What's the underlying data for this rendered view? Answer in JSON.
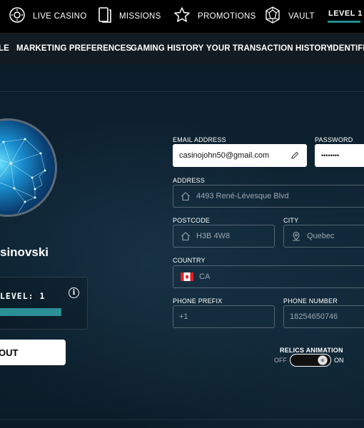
{
  "nav": {
    "items": [
      {
        "label": "LIVE CASINO",
        "icon": "roulette-icon"
      },
      {
        "label": "MISSIONS",
        "icon": "cards-icon"
      },
      {
        "label": "PROMOTIONS",
        "icon": "star-icon"
      },
      {
        "label": "VAULT",
        "icon": "gem-icon"
      }
    ],
    "level_label": "LEVEL 1",
    "level_color": "#1f8e8e"
  },
  "tabs": [
    {
      "label": "LE"
    },
    {
      "label": "MARKETING PREFERENCES"
    },
    {
      "label": "GAMING HISTORY"
    },
    {
      "label": "YOUR TRANSACTION HISTORY"
    },
    {
      "label": "IDENTIFI"
    }
  ],
  "profile": {
    "username": "sinovski",
    "level_text": "LEVEL: 1",
    "progress": 1.0,
    "progress_color": "#2b8f96",
    "logout_label": "OUT"
  },
  "form": {
    "email": {
      "label": "EMAIL ADDRESS",
      "value": "casinojohn50@gmail.com"
    },
    "password": {
      "label": "PASSWORD",
      "value": "••••••••"
    },
    "address": {
      "label": "ADDRESS",
      "value": "4493 René-Lévesque Blvd"
    },
    "postcode": {
      "label": "POSTCODE",
      "value": "H3B 4W8"
    },
    "city": {
      "label": "CITY",
      "value": "Quebec"
    },
    "country": {
      "label": "COUNTRY",
      "value": "CA"
    },
    "phone_prefix": {
      "label": "PHONE PREFIX",
      "value": "+1"
    },
    "phone_number": {
      "label": "PHONE NUMBER",
      "value": "18254650746"
    }
  },
  "relics": {
    "label": "RELICS ANIMATION",
    "off": "OFF",
    "on": "ON",
    "enabled": true
  }
}
